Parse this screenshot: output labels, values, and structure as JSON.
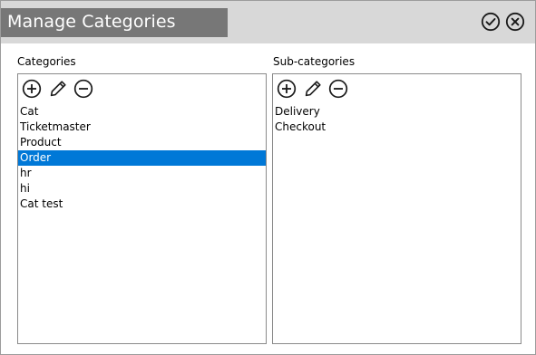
{
  "window": {
    "title": "Manage Categories",
    "ok_icon": "check-circle-icon",
    "close_icon": "x-circle-icon"
  },
  "categories": {
    "label": "Categories",
    "toolbar": {
      "add_icon": "plus-circle-icon",
      "edit_icon": "pencil-icon",
      "remove_icon": "minus-circle-icon"
    },
    "items": [
      "Cat",
      "Ticketmaster",
      "Product",
      "Order",
      "hr",
      "hi",
      "Cat test"
    ],
    "selected_index": 3
  },
  "subcategories": {
    "label": "Sub-categories",
    "toolbar": {
      "add_icon": "plus-circle-icon",
      "edit_icon": "pencil-icon",
      "remove_icon": "minus-circle-icon"
    },
    "items": [
      "Delivery",
      "Checkout"
    ]
  },
  "colors": {
    "selection": "#0078d7",
    "title_bar": "#d8d8d8",
    "title_box": "#777777"
  }
}
